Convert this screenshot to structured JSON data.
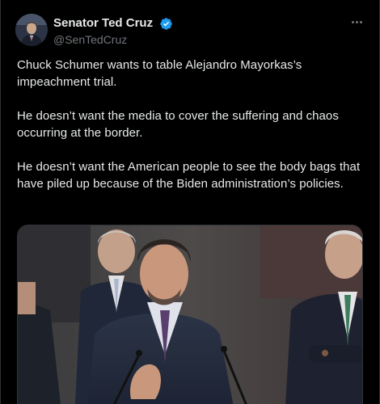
{
  "author": {
    "display_name": "Senator Ted Cruz",
    "handle": "@SenTedCruz",
    "verified_icon": "verified-badge-icon",
    "verified_color": "#1d9bf0"
  },
  "more_icon": "more-options-icon",
  "tweet": {
    "paragraphs": [
      "Chuck Schumer wants to table Alejandro Mayorkas’s impeachment trial.",
      "He doesn’t want the media to cover the suffering and chaos occurring at the border.",
      "He doesn’t want the American people to see the body bags that have piled up because of the Biden administration’s policies."
    ]
  },
  "colors": {
    "background": "#000000",
    "text": "#e7e9ea",
    "secondary_text": "#71767b",
    "border": "#2f3336"
  }
}
